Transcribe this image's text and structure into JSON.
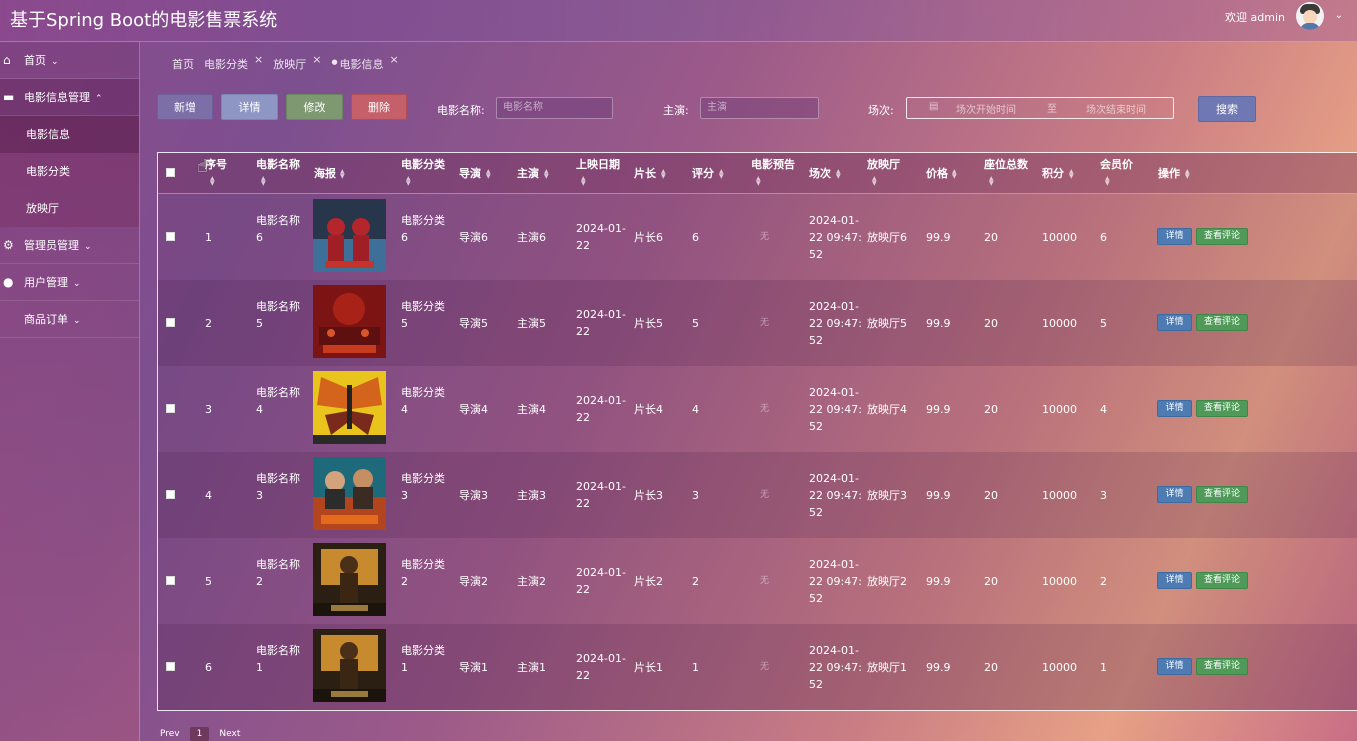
{
  "header": {
    "title": "基于Spring Boot的电影售票系统",
    "welcome": "欢迎 admin"
  },
  "sidebar": {
    "items": [
      {
        "label": "首页",
        "icon": "home-icon"
      },
      {
        "label": "电影信息管理",
        "icon": "folder-icon",
        "children": [
          "电影信息",
          "电影分类",
          "放映厅"
        ]
      },
      {
        "label": "管理员管理",
        "icon": "gear-icon"
      },
      {
        "label": "用户管理",
        "icon": "user-icon"
      },
      {
        "label": "商品订单",
        "icon": ""
      }
    ]
  },
  "tabs": [
    {
      "label": "首页"
    },
    {
      "label": "电影分类"
    },
    {
      "label": "放映厅"
    },
    {
      "label": "电影信息"
    }
  ],
  "toolbar": {
    "add": "新增",
    "detail": "详情",
    "edit": "修改",
    "delete": "删除",
    "search": "搜索"
  },
  "filters": {
    "name_label": "电影名称:",
    "name_placeholder": "电影名称",
    "actor_label": "主演:",
    "actor_placeholder": "主演",
    "session_label": "场次:",
    "start_placeholder": "场次开始时间",
    "end_placeholder": "场次结束时间",
    "separator": "至"
  },
  "table": {
    "columns": [
      "序号",
      "电影名称",
      "海报",
      "电影分类",
      "导演",
      "主演",
      "上映日期",
      "片长",
      "评分",
      "电影预告",
      "场次",
      "放映厅",
      "价格",
      "座位总数",
      "积分",
      "会员价",
      "操作"
    ],
    "rows": [
      {
        "idx": "1",
        "name": "电影名称\n6",
        "cat": "电影分类\n6",
        "director": "导演6",
        "actor": "主演6",
        "date": "2024-01-\n22",
        "length": "片长6",
        "score": "6",
        "trailer": "无",
        "session": "2024-01-\n22 09:47:\n52",
        "hall": "放映厅6",
        "price": "99.9",
        "seats": "20",
        "points": "10000",
        "vip": "6"
      },
      {
        "idx": "2",
        "name": "电影名称\n5",
        "cat": "电影分类\n5",
        "director": "导演5",
        "actor": "主演5",
        "date": "2024-01-\n22",
        "length": "片长5",
        "score": "5",
        "trailer": "无",
        "session": "2024-01-\n22 09:47:\n52",
        "hall": "放映厅5",
        "price": "99.9",
        "seats": "20",
        "points": "10000",
        "vip": "5"
      },
      {
        "idx": "3",
        "name": "电影名称\n4",
        "cat": "电影分类\n4",
        "director": "导演4",
        "actor": "主演4",
        "date": "2024-01-\n22",
        "length": "片长4",
        "score": "4",
        "trailer": "无",
        "session": "2024-01-\n22 09:47:\n52",
        "hall": "放映厅4",
        "price": "99.9",
        "seats": "20",
        "points": "10000",
        "vip": "4"
      },
      {
        "idx": "4",
        "name": "电影名称\n3",
        "cat": "电影分类\n3",
        "director": "导演3",
        "actor": "主演3",
        "date": "2024-01-\n22",
        "length": "片长3",
        "score": "3",
        "trailer": "无",
        "session": "2024-01-\n22 09:47:\n52",
        "hall": "放映厅3",
        "price": "99.9",
        "seats": "20",
        "points": "10000",
        "vip": "3"
      },
      {
        "idx": "5",
        "name": "电影名称\n2",
        "cat": "电影分类\n2",
        "director": "导演2",
        "actor": "主演2",
        "date": "2024-01-\n22",
        "length": "片长2",
        "score": "2",
        "trailer": "无",
        "session": "2024-01-\n22 09:47:\n52",
        "hall": "放映厅2",
        "price": "99.9",
        "seats": "20",
        "points": "10000",
        "vip": "2"
      },
      {
        "idx": "6",
        "name": "电影名称\n1",
        "cat": "电影分类\n1",
        "director": "导演1",
        "actor": "主演1",
        "date": "2024-01-\n22",
        "length": "片长1",
        "score": "1",
        "trailer": "无",
        "session": "2024-01-\n22 09:47:\n52",
        "hall": "放映厅1",
        "price": "99.9",
        "seats": "20",
        "points": "10000",
        "vip": "1"
      }
    ],
    "row_detail_label": "详情",
    "row_review_label": "查看评论"
  },
  "pagination": {
    "prev": "Prev",
    "page": "1",
    "next": "Next"
  },
  "colors": {
    "add_button": "#7c6fa8",
    "detail_button": "#8e96c4",
    "edit_button": "#7e9872",
    "delete_button": "#c5606a",
    "search_button": "#6f78b2",
    "row_detail_button": "#4d7bb2",
    "row_review_button": "#4f9a58"
  }
}
